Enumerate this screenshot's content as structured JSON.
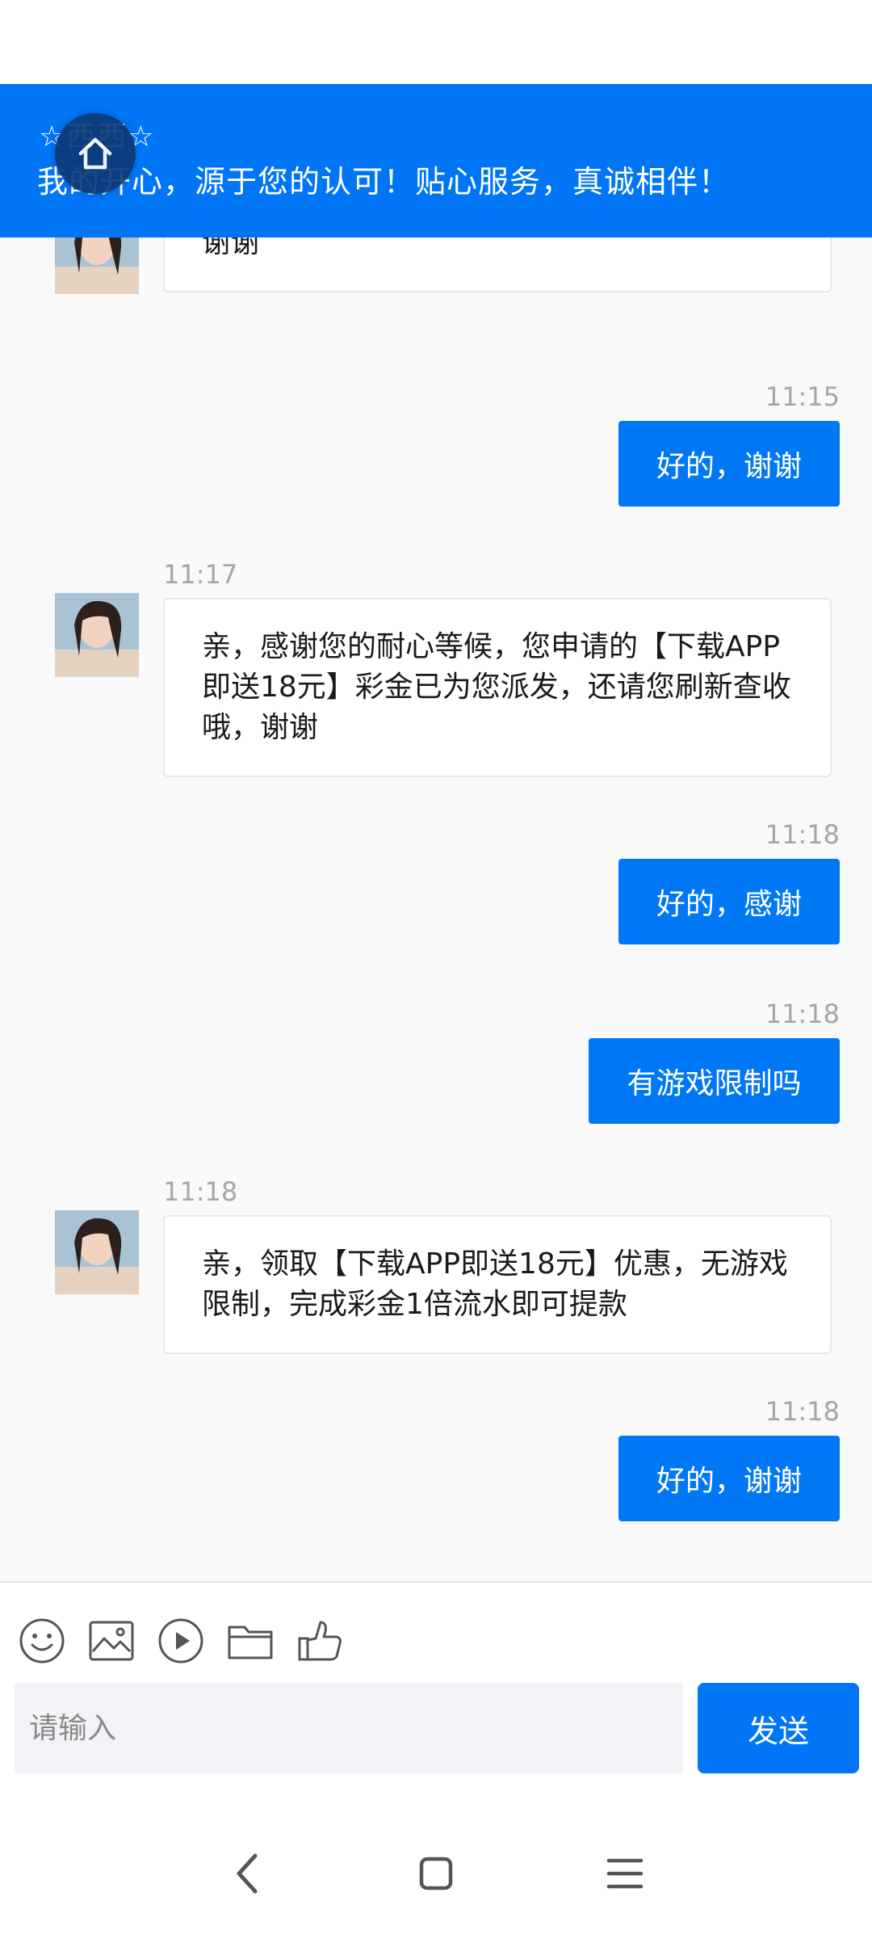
{
  "header": {
    "agent_name": "☆西西☆",
    "slogan": "我的开心，源于您的认可！贴心服务，真诚相伴！"
  },
  "messages": [
    {
      "from": "agent",
      "text": "好的，立即为您提交申请，还请您稍后下哦，谢谢"
    },
    {
      "from": "user",
      "time": "11:15",
      "text": "好的，谢谢"
    },
    {
      "from": "agent",
      "time": "11:17",
      "text": "亲，感谢您的耐心等候，您申请的【下载APP即送18元】彩金已为您派发，还请您刷新查收哦，谢谢"
    },
    {
      "from": "user",
      "time": "11:18",
      "text": "好的，感谢"
    },
    {
      "from": "user",
      "time": "11:18",
      "text": "有游戏限制吗"
    },
    {
      "from": "agent",
      "time": "11:18",
      "text": "亲，领取【下载APP即送18元】优惠，无游戏限制，完成彩金1倍流水即可提款"
    },
    {
      "from": "user",
      "time": "11:18",
      "text": "好的，谢谢"
    }
  ],
  "input": {
    "placeholder": "请输入",
    "send_label": "发送"
  },
  "toolbar_icons": [
    "emoji-icon",
    "image-icon",
    "video-icon",
    "folder-icon",
    "thumbs-up-icon"
  ],
  "nav_icons": [
    "back-icon",
    "home-icon",
    "menu-icon"
  ],
  "colors": {
    "accent": "#0076f6",
    "bubble_user": "#0078f5",
    "background": "#f9f9f9",
    "time_text": "#a6a6a6"
  }
}
